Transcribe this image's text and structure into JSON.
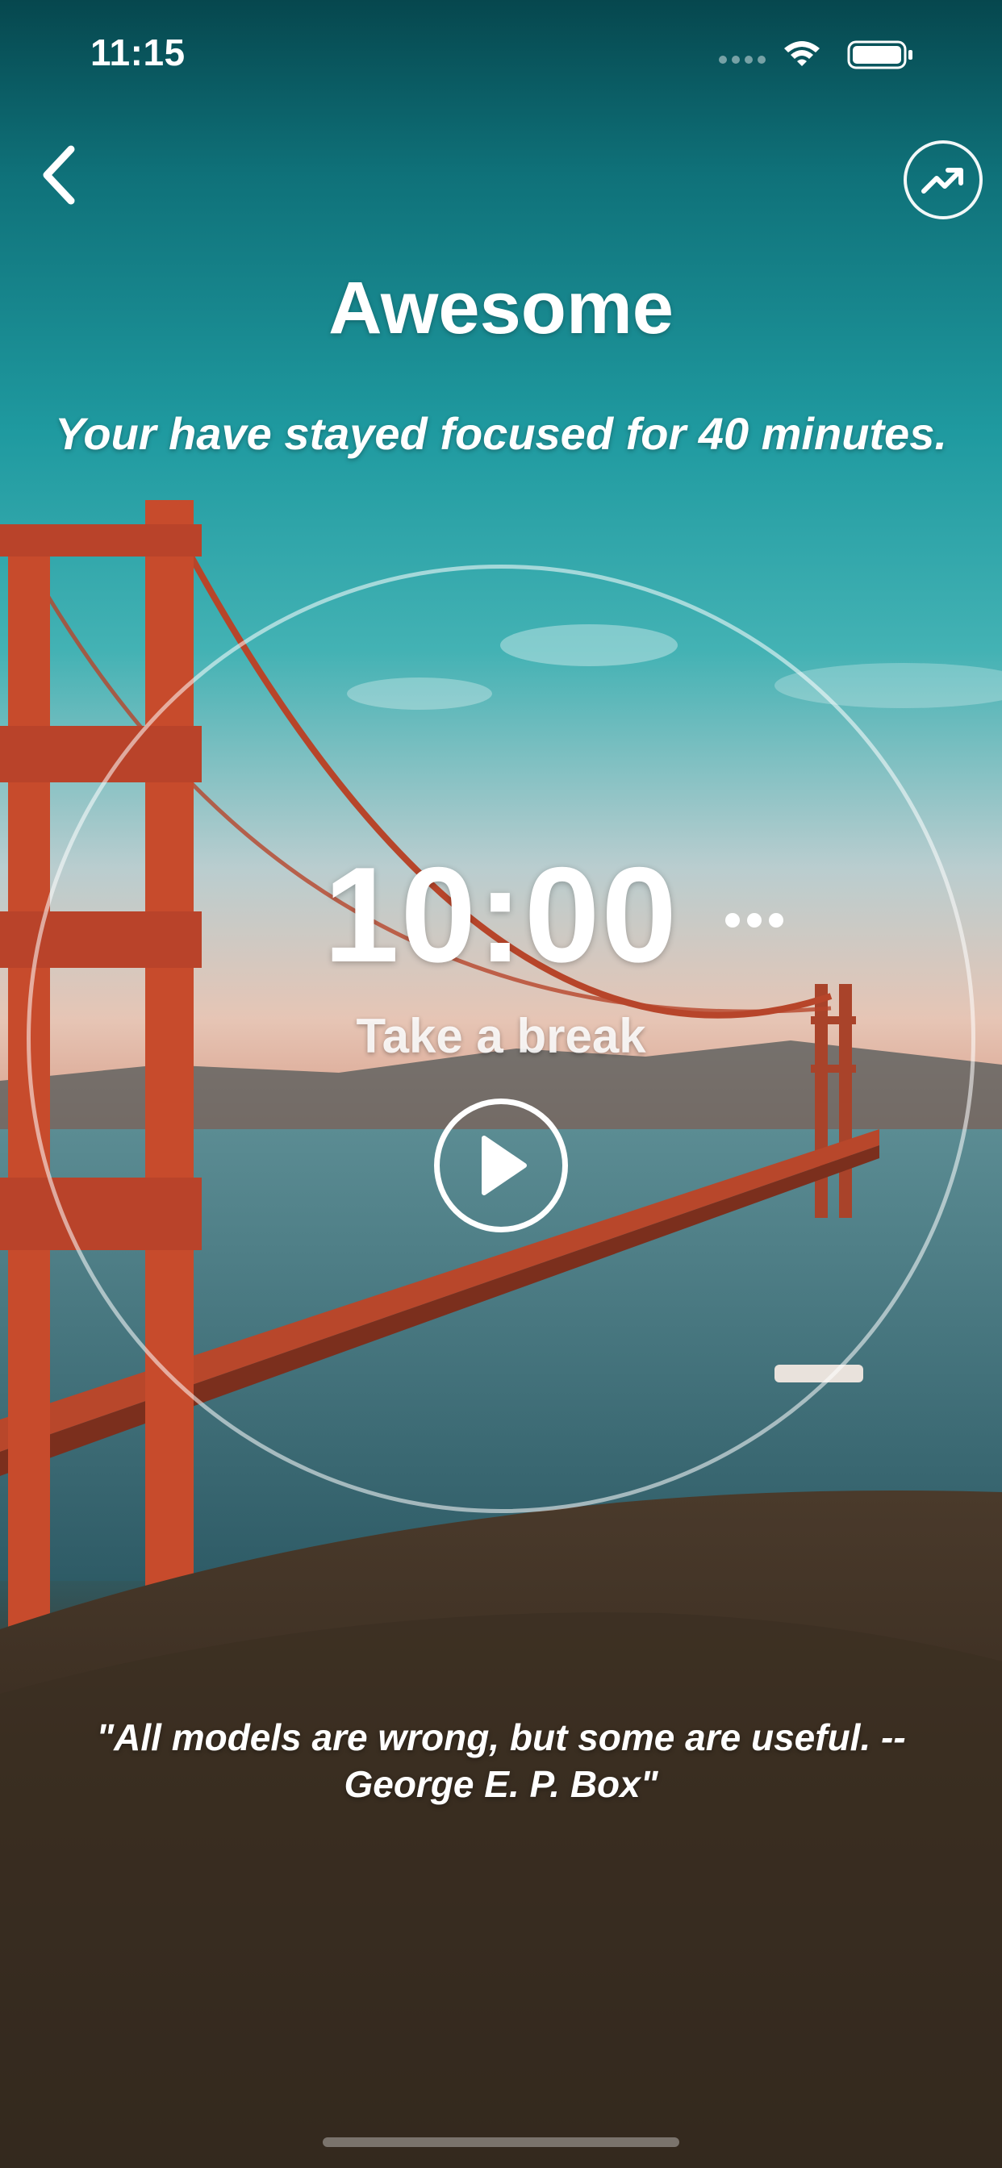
{
  "status_bar": {
    "time": "11:15",
    "icons": [
      "signal-icon",
      "wifi-icon",
      "battery-icon"
    ]
  },
  "header": {
    "back_icon": "chevron-left-icon",
    "stats_icon": "trending-up-icon"
  },
  "main": {
    "title": "Awesome",
    "subtitle": "Your have stayed focused for 40 minutes."
  },
  "timer": {
    "time": "10:00",
    "status": "Take a break",
    "more_icon": "more-dots-icon",
    "play_icon": "play-icon"
  },
  "quote": {
    "text": "\"All models are wrong, but some are useful. -- George E. P. Box\""
  },
  "colors": {
    "sky_top": "#06474e",
    "sky_teal": "#1f9aa0",
    "bridge": "#c2492a",
    "ground": "#382b20",
    "text": "#ffffff"
  }
}
